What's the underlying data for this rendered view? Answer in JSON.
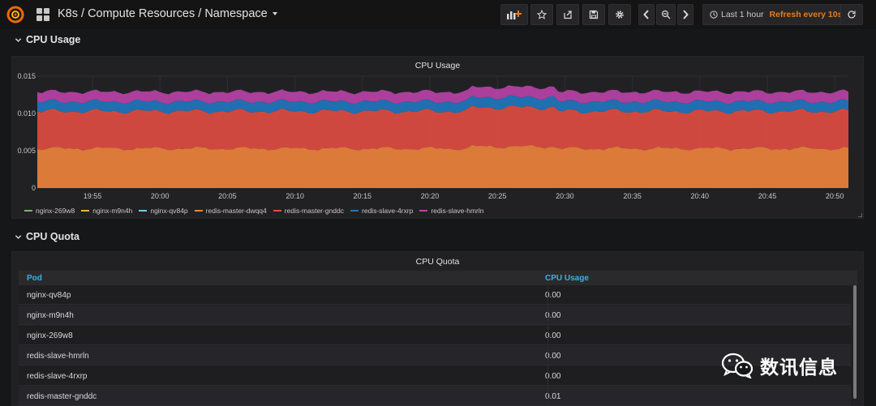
{
  "navbar": {
    "dashboard_title": "K8s / Compute Resources / Namespace",
    "time_range": "Last 1 hour",
    "refresh": "Refresh every 10s",
    "icons": [
      "grafana-logo-icon",
      "dashboards-grid-icon",
      "add-panel-icon",
      "star-icon",
      "share-icon",
      "save-icon",
      "gear-icon",
      "chevron-left-icon",
      "zoom-out-icon",
      "chevron-right-icon",
      "clock-icon",
      "refresh-icon"
    ]
  },
  "rows": {
    "cpu_usage": "CPU Usage",
    "cpu_quota": "CPU Quota"
  },
  "chart_panel": {
    "title": "CPU Usage"
  },
  "chart_data": {
    "type": "area",
    "title": "CPU Usage",
    "stacked": true,
    "x_ticks": [
      "19:55",
      "20:00",
      "20:05",
      "20:10",
      "20:15",
      "20:20",
      "20:25",
      "20:30",
      "20:35",
      "20:40",
      "20:45",
      "20:50"
    ],
    "y_ticks": [
      "0.015",
      "0.010",
      "0.005",
      "0"
    ],
    "ylim": [
      0,
      0.015
    ],
    "grid": true,
    "legend_position": "bottom",
    "series": [
      {
        "name": "nginx-269w8",
        "color": "#7eb26d",
        "value": 0.0
      },
      {
        "name": "nginx-m9n4h",
        "color": "#eab839",
        "value": 0.0
      },
      {
        "name": "nginx-qv84p",
        "color": "#6ed0e0",
        "value": 0.0
      },
      {
        "name": "redis-master-dwqq4",
        "color": "#ef843c",
        "value": 0.0053
      },
      {
        "name": "redis-master-gnddc",
        "color": "#e24d42",
        "value": 0.005
      },
      {
        "name": "redis-slave-4rxrp",
        "color": "#1f78c1",
        "value": 0.0013
      },
      {
        "name": "redis-slave-hmrln",
        "color": "#ba43a9",
        "value": 0.0013
      }
    ]
  },
  "table_panel": {
    "title": "CPU Quota",
    "columns": [
      "Pod",
      "CPU Usage"
    ],
    "rows": [
      {
        "pod": "nginx-qv84p",
        "cpu": "0.00"
      },
      {
        "pod": "nginx-m9n4h",
        "cpu": "0.00"
      },
      {
        "pod": "nginx-269w8",
        "cpu": "0.00"
      },
      {
        "pod": "redis-slave-hmrln",
        "cpu": "0.00"
      },
      {
        "pod": "redis-slave-4rxrp",
        "cpu": "0.00"
      },
      {
        "pod": "redis-master-gnddc",
        "cpu": "0.01"
      }
    ]
  },
  "watermark": {
    "text": "数讯信息"
  }
}
